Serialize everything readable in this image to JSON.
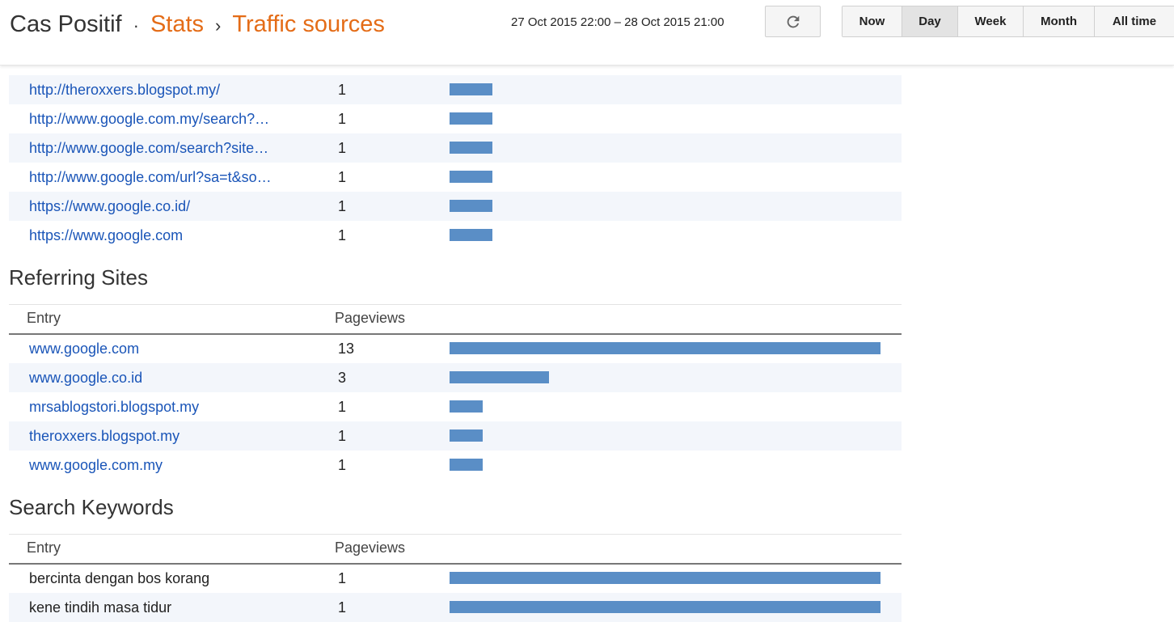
{
  "header": {
    "blog_name": "Cas Positif",
    "separator": "·",
    "stats_label": "Stats",
    "chevron": "›",
    "page_label": "Traffic sources",
    "date_range": "27 Oct 2015 22:00 – 28 Oct 2015 21:00",
    "refresh_icon": "refresh-icon",
    "ranges": [
      "Now",
      "Day",
      "Week",
      "Month",
      "All time"
    ],
    "active_range": "Day"
  },
  "referring_urls": {
    "rows": [
      {
        "entry": "http://theroxxers.blogspot.my/",
        "pageviews": 1
      },
      {
        "entry": "http://www.google.com.my/search?…",
        "pageviews": 1
      },
      {
        "entry": "http://www.google.com/search?site…",
        "pageviews": 1
      },
      {
        "entry": "http://www.google.com/url?sa=t&so…",
        "pageviews": 1
      },
      {
        "entry": "https://www.google.co.id/",
        "pageviews": 1
      },
      {
        "entry": "https://www.google.com",
        "pageviews": 1
      }
    ]
  },
  "referring_sites": {
    "title": "Referring Sites",
    "col_entry": "Entry",
    "col_pageviews": "Pageviews",
    "rows": [
      {
        "entry": "www.google.com",
        "pageviews": 13
      },
      {
        "entry": "www.google.co.id",
        "pageviews": 3
      },
      {
        "entry": "mrsablogstori.blogspot.my",
        "pageviews": 1
      },
      {
        "entry": "theroxxers.blogspot.my",
        "pageviews": 1
      },
      {
        "entry": "www.google.com.my",
        "pageviews": 1
      }
    ]
  },
  "search_keywords": {
    "title": "Search Keywords",
    "col_entry": "Entry",
    "col_pageviews": "Pageviews",
    "rows": [
      {
        "entry": "bercinta dengan bos korang",
        "pageviews": 1
      },
      {
        "entry": "kene tindih masa tidur",
        "pageviews": 1
      }
    ]
  },
  "colors": {
    "bar": "#5a8ec6",
    "link": "#1a55b8",
    "accent": "#e46c17",
    "row_alt": "#f3f6fb"
  }
}
